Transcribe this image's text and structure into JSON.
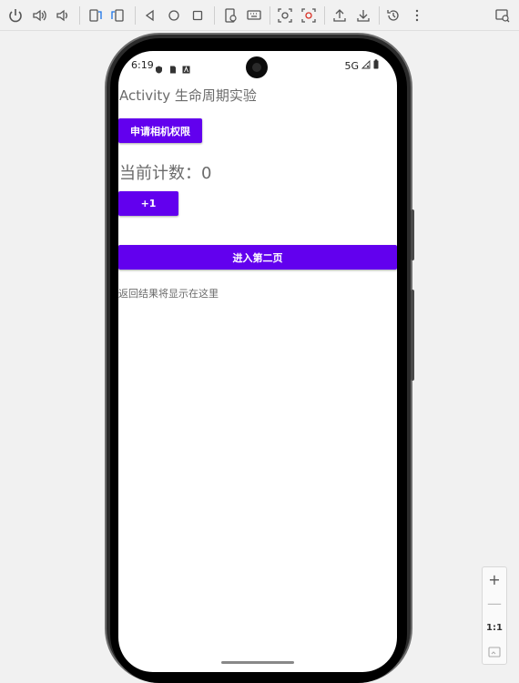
{
  "toolbar": {
    "icons": [
      "power-icon",
      "volume-up-icon",
      "volume-down-icon",
      "rotate-left-icon",
      "rotate-right-icon",
      "back-icon",
      "home-icon",
      "overview-icon",
      "screenshot-icon",
      "keyboard-icon",
      "camera-snapshot-icon",
      "record-icon",
      "upload-icon",
      "download-icon",
      "history-icon",
      "more-icon",
      "device-search-icon"
    ]
  },
  "status_bar": {
    "time": "6:19",
    "network": "5G"
  },
  "app": {
    "title": "Activity 生命周期实验",
    "request_camera_button": "申请相机权限",
    "counter_text": "当前计数：0",
    "increment_button": "+1",
    "next_page_button": "进入第二页",
    "result_text": "返回结果将显示在这里"
  },
  "zoom_panel": {
    "zoom_in": "+",
    "zoom_out": "—",
    "ratio": "1:1"
  },
  "colors": {
    "accent": "#6200ee"
  }
}
